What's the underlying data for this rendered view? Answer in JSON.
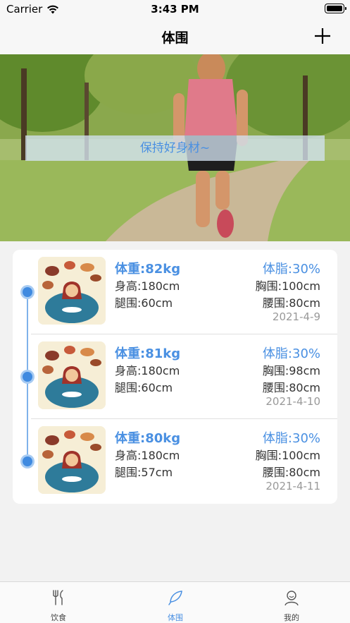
{
  "status_bar": {
    "carrier": "Carrier",
    "time": "3:43 PM"
  },
  "nav": {
    "title": "体围",
    "add_icon": "plus-icon"
  },
  "banner": {
    "caption": "保持好身材~"
  },
  "records": [
    {
      "weight": "体重:82kg",
      "height": "身高:180cm",
      "thigh": "腿围:60cm",
      "bodyfat": "体脂:30%",
      "chest": "胸围:100cm",
      "waist": "腰围:80cm",
      "date": "2021-4-9"
    },
    {
      "weight": "体重:81kg",
      "height": "身高:180cm",
      "thigh": "腿围:60cm",
      "bodyfat": "体脂:30%",
      "chest": "胸围:98cm",
      "waist": "腰围:80cm",
      "date": "2021-4-10"
    },
    {
      "weight": "体重:80kg",
      "height": "身高:180cm",
      "thigh": "腿围:57cm",
      "bodyfat": "体脂:30%",
      "chest": "胸围:100cm",
      "waist": "腰围:80cm",
      "date": "2021-4-11"
    }
  ],
  "tabs": [
    {
      "label": "饮食",
      "icon": "fork-knife-icon",
      "active": false
    },
    {
      "label": "体围",
      "icon": "feather-icon",
      "active": true
    },
    {
      "label": "我的",
      "icon": "person-icon",
      "active": false
    }
  ],
  "colors": {
    "accent": "#4a90e2",
    "timeline": "#3f8ae0"
  }
}
